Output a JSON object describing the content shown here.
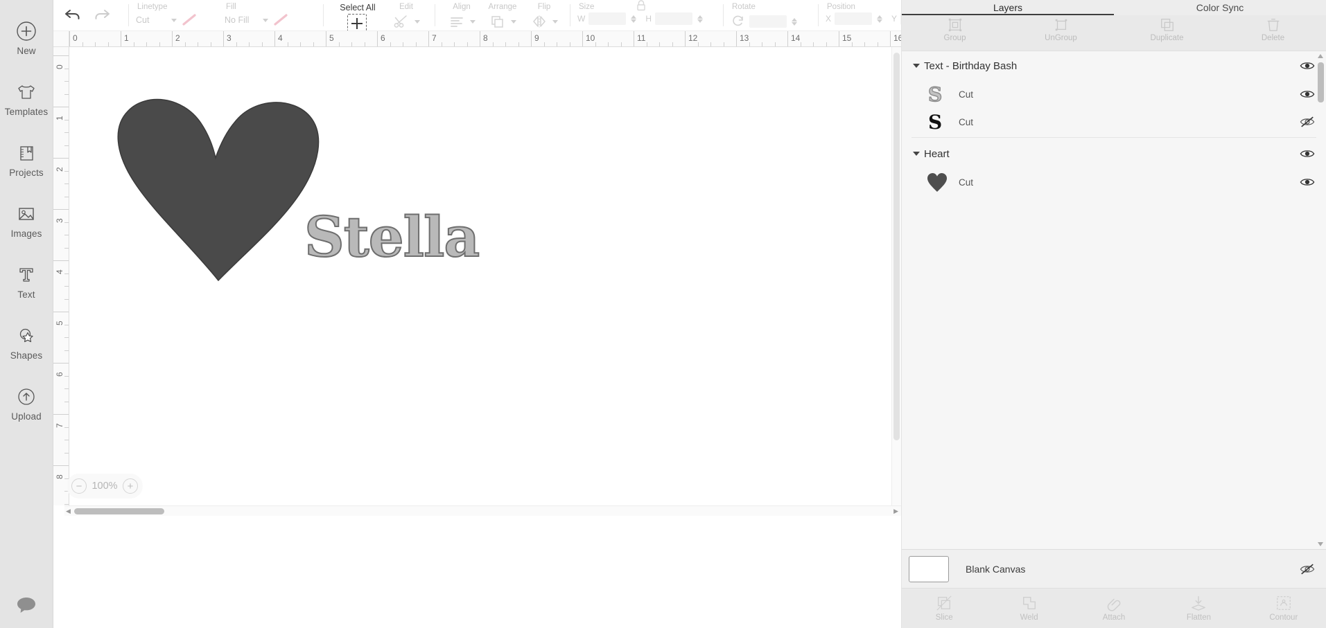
{
  "sidebar": {
    "items": [
      {
        "label": "New",
        "icon": "plus-circle-icon"
      },
      {
        "label": "Templates",
        "icon": "tshirt-icon"
      },
      {
        "label": "Projects",
        "icon": "book-bookmark-icon"
      },
      {
        "label": "Images",
        "icon": "picture-icon"
      },
      {
        "label": "Text",
        "icon": "text-t-icon"
      },
      {
        "label": "Shapes",
        "icon": "shapes-star-icon"
      },
      {
        "label": "Upload",
        "icon": "upload-cloud-icon"
      }
    ],
    "chat_icon": "chat-bubble-icon"
  },
  "toolbar": {
    "undo": "undo-arrow-icon",
    "redo": "redo-arrow-icon",
    "groups": [
      {
        "title": "Linetype",
        "value": "Cut",
        "name": "linetype"
      },
      {
        "title": "Fill",
        "value": "No Fill",
        "name": "fill"
      }
    ],
    "select_all": "Select All",
    "edit": "Edit",
    "align": "Align",
    "arrange": "Arrange",
    "flip": "Flip",
    "size": "Size",
    "size_w": "W",
    "size_h": "H",
    "rotate": "Rotate",
    "position": "Position",
    "position_x": "X",
    "position_y": "Y",
    "lock_icon": "lock-icon"
  },
  "rulers": {
    "horizontal": [
      "0",
      "1",
      "2",
      "3",
      "4",
      "5",
      "6",
      "7",
      "8",
      "9",
      "10",
      "11",
      "12",
      "13",
      "14",
      "15",
      "16"
    ],
    "vertical": [
      "0",
      "1",
      "2",
      "3",
      "4",
      "5",
      "6",
      "7",
      "8"
    ],
    "unit_spacing_px": 74
  },
  "canvas": {
    "zoom": "100%",
    "zoom_out_label": "−",
    "zoom_in_label": "+",
    "artwork": {
      "heart": {
        "name": "heart-shape",
        "color": "#4a4a4a"
      },
      "text": {
        "name": "stella-text",
        "content": "Stella",
        "fill": "#b9b9b9",
        "stroke": "#6e6e6e"
      }
    }
  },
  "right_panel": {
    "tabs": [
      {
        "label": "Layers",
        "active": true
      },
      {
        "label": "Color Sync",
        "active": false
      }
    ],
    "actions": [
      {
        "label": "Group",
        "icon": "group-icon",
        "enabled": false
      },
      {
        "label": "UnGroup",
        "icon": "ungroup-icon",
        "enabled": false
      },
      {
        "label": "Duplicate",
        "icon": "duplicate-icon",
        "enabled": false
      },
      {
        "label": "Delete",
        "icon": "trash-icon",
        "enabled": false
      }
    ],
    "layer_groups": [
      {
        "title": "Text - Birthday Bash",
        "visible": true,
        "expanded": true,
        "children": [
          {
            "label": "Cut",
            "thumb": "letter-s-outline",
            "visible": true
          },
          {
            "label": "Cut",
            "thumb": "letter-s-solid",
            "visible": false
          }
        ]
      },
      {
        "title": "Heart",
        "visible": true,
        "expanded": true,
        "children": [
          {
            "label": "Cut",
            "thumb": "heart-solid",
            "visible": true
          }
        ]
      }
    ],
    "canvas_row": {
      "label": "Blank Canvas",
      "visible": false,
      "swatch": "#ffffff"
    },
    "bottom_tools": [
      {
        "label": "Slice",
        "icon": "slice-icon"
      },
      {
        "label": "Weld",
        "icon": "weld-icon"
      },
      {
        "label": "Attach",
        "icon": "attach-icon"
      },
      {
        "label": "Flatten",
        "icon": "flatten-icon"
      },
      {
        "label": "Contour",
        "icon": "contour-icon"
      }
    ]
  },
  "colors": {
    "rail_bg": "#e4e4e4",
    "panel_bg": "#f6f6f6",
    "accent_underline": "#3d3d3d",
    "art_dark": "#4a4a4a",
    "art_light": "#b9b9b9"
  }
}
